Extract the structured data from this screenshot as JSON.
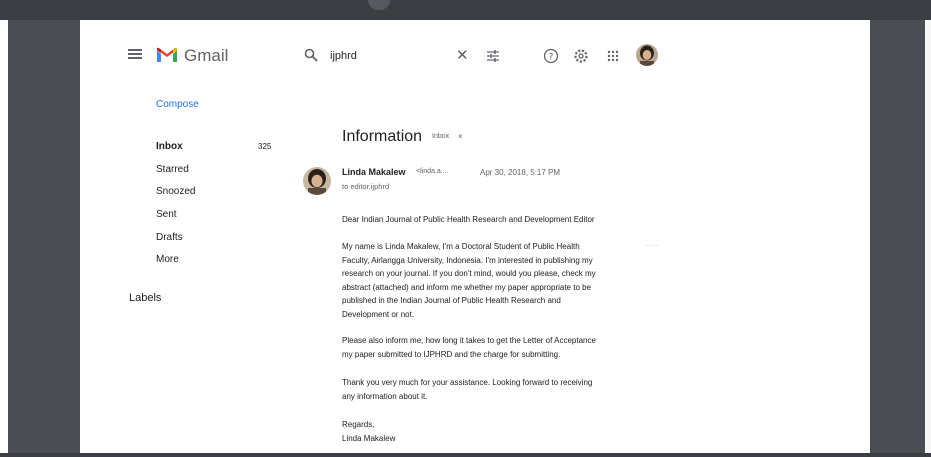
{
  "header": {
    "brand": "Gmail",
    "search_query": "ijphrd",
    "icons": [
      "menu-icon",
      "gmail-logo",
      "search-icon",
      "clear-icon",
      "filter-icon",
      "help-icon",
      "settings-icon",
      "apps-icon",
      "avatar"
    ]
  },
  "sidebar": {
    "compose": "Compose",
    "items": [
      {
        "label": "Inbox",
        "count": "325"
      },
      {
        "label": "Starred"
      },
      {
        "label": "Snoozed"
      },
      {
        "label": "Sent"
      },
      {
        "label": "Drafts"
      },
      {
        "label": "More"
      }
    ],
    "labels_heading": "Labels"
  },
  "message": {
    "subject": "Information",
    "label_chip": "Inbox",
    "chip_close": "×",
    "sender_name": "Linda Makalew",
    "sender_email": "<linda.a....",
    "date": "Apr 30, 2018, 5:17 PM",
    "to": "to editor.ijphrd",
    "body": {
      "greeting": "Dear Indian Journal of Public Health Research and Development Editor",
      "p1": [
        "My name is Linda Makalew, I'm a Doctoral Student of Public Health",
        "Faculty, Airlangga University, Indonesia. I'm interested in publishing my",
        "research on your journal. If you don't mind, would you please, check my",
        "abstract (attached) and inform me whether my paper appropriate to be",
        "published in the Indian Journal of Public Health Research and",
        "Development or not."
      ],
      "p2": [
        "Please also inform me, how long it takes to get the Letter of Acceptance",
        "my paper submitted to IJPHRD and the charge for submitting."
      ],
      "p3": [
        "Thank you very much for your assistance. Looking forward to receiving",
        "any information about it."
      ],
      "signoff": [
        "Regards,",
        "Linda Makalew"
      ]
    }
  },
  "colors": {
    "frame": "#4a4d52",
    "link": "#1a73e8",
    "gmail_red": "#ea4335",
    "gmail_blue": "#4285f4",
    "gmail_yellow": "#fbbc04",
    "gmail_green": "#34a853"
  }
}
